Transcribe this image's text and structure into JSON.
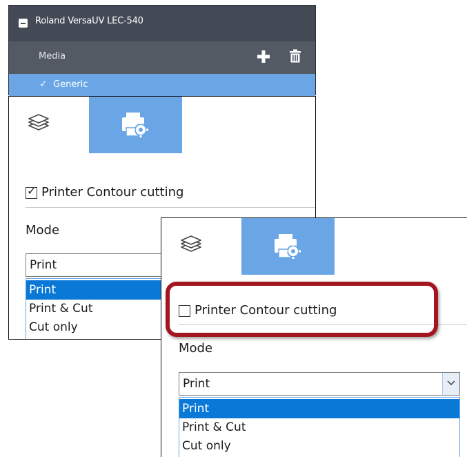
{
  "device": {
    "title": "Roland VersaUV LEC-540",
    "media_label": "Media",
    "selected_media": "Generic"
  },
  "panel_a": {
    "contour_label": "Printer Contour cutting",
    "contour_checked": true,
    "mode_label": "Mode",
    "mode_value": "Print",
    "options": [
      "Print",
      "Print & Cut",
      "Cut only"
    ],
    "selected_option": "Print"
  },
  "panel_b": {
    "contour_label": "Printer Contour cutting",
    "contour_checked": false,
    "mode_label": "Mode",
    "mode_value": "Print",
    "options": [
      "Print",
      "Print & Cut",
      "Cut only"
    ],
    "selected_option": "Print"
  },
  "icons": {
    "collapse": "minus-square-icon",
    "add": "plus-icon",
    "delete": "trash-icon",
    "selected": "check-icon",
    "tab_layers": "layers-icon",
    "tab_output": "printer-settings-icon",
    "dropdown": "chevron-down-icon"
  },
  "colors": {
    "header_bg": "#444a55",
    "media_row_bg": "#535a64",
    "accent_blue": "#6aa6e6",
    "option_selected": "#0a78d7",
    "highlight_red": "#a31620"
  }
}
